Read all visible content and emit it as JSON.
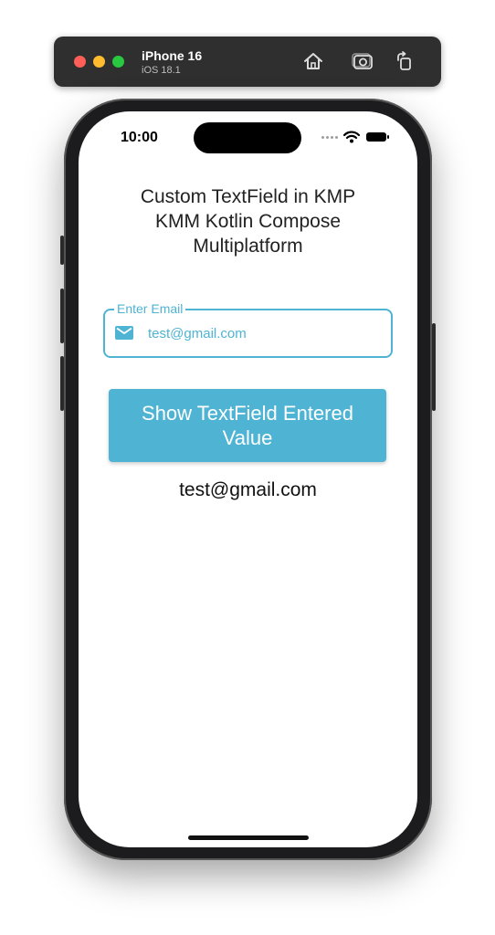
{
  "simulator": {
    "device_name": "iPhone 16",
    "os_version": "iOS 18.1",
    "buttons": {
      "home": "house-icon",
      "screenshot": "camera-icon",
      "rotate": "rotate-icon"
    }
  },
  "status_bar": {
    "time": "10:00"
  },
  "app": {
    "title_line1": "Custom TextField in KMP",
    "title_line2": "KMM Kotlin Compose",
    "title_line3": "Multiplatform",
    "email_field": {
      "label": "Enter Email",
      "value": "test@gmail.com",
      "icon": "mail-icon"
    },
    "show_button_label": "Show TextField Entered Value",
    "result_text": "test@gmail.com"
  },
  "colors": {
    "accent": "#4fb3d4",
    "simbar": "#2f2f2f"
  }
}
